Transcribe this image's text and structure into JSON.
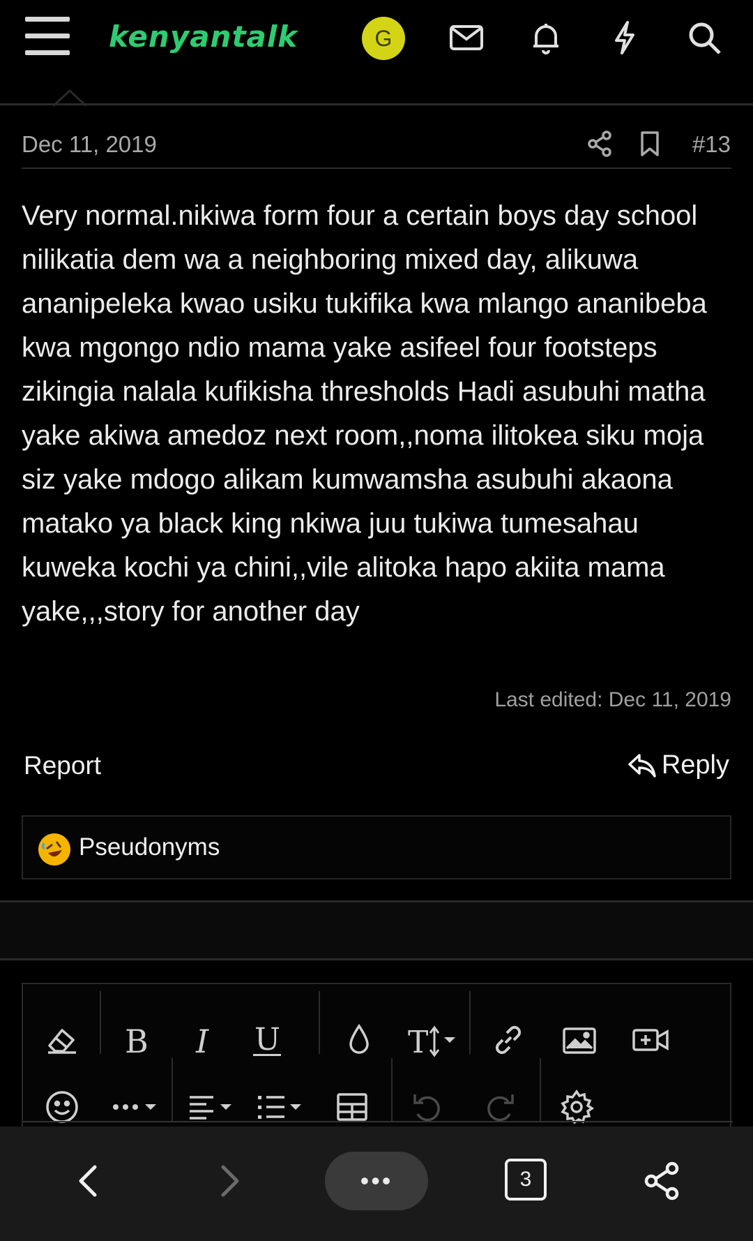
{
  "header": {
    "logo_text": "kenyantalk",
    "avatar_letter": "G",
    "icons": [
      "menu-icon",
      "mail-icon",
      "bell-icon",
      "lightning-icon",
      "search-icon"
    ]
  },
  "post": {
    "date": "Dec 11, 2019",
    "number": "#13",
    "body": "Very normal.nikiwa form four a certain boys day school nilikatia dem wa a neighboring mixed day, alikuwa ananipeleka kwao usiku tukifika kwa mlango ananibeba kwa mgongo ndio mama yake asifeel four footsteps zikingia nalala kufikisha thresholds Hadi asubuhi matha yake akiwa amedoz next room,,noma ilitokea siku moja siz yake mdogo alikam kumwamsha asubuhi akaona matako ya black king nkiwa juu tukiwa tumesahau kuweka kochi ya chini,,vile alitoka hapo akiita mama yake,,,story for another day",
    "last_edited": "Last edited: Dec 11, 2019",
    "report_label": "Report",
    "reply_label": "Reply"
  },
  "reactions": {
    "users": "Pseudonyms",
    "emoji": "rofl-emoji"
  },
  "editor_toolbar": {
    "row1": [
      "eraser-icon",
      "bold-icon",
      "italic-icon",
      "underline-icon",
      "color-drop-icon",
      "text-size-icon",
      "link-icon",
      "image-icon",
      "video-icon"
    ],
    "row2": [
      "smiley-icon",
      "more-options-icon",
      "align-icon",
      "list-icon",
      "table-icon",
      "undo-icon",
      "redo-icon",
      "settings-icon"
    ]
  },
  "browser_bar": {
    "tab_count": "3",
    "more_label": "•••"
  },
  "colors": {
    "background": "#000000",
    "logo_green": "#2ecc71",
    "avatar_yellow": "#d4d416",
    "muted_text": "#a9a9a9"
  }
}
